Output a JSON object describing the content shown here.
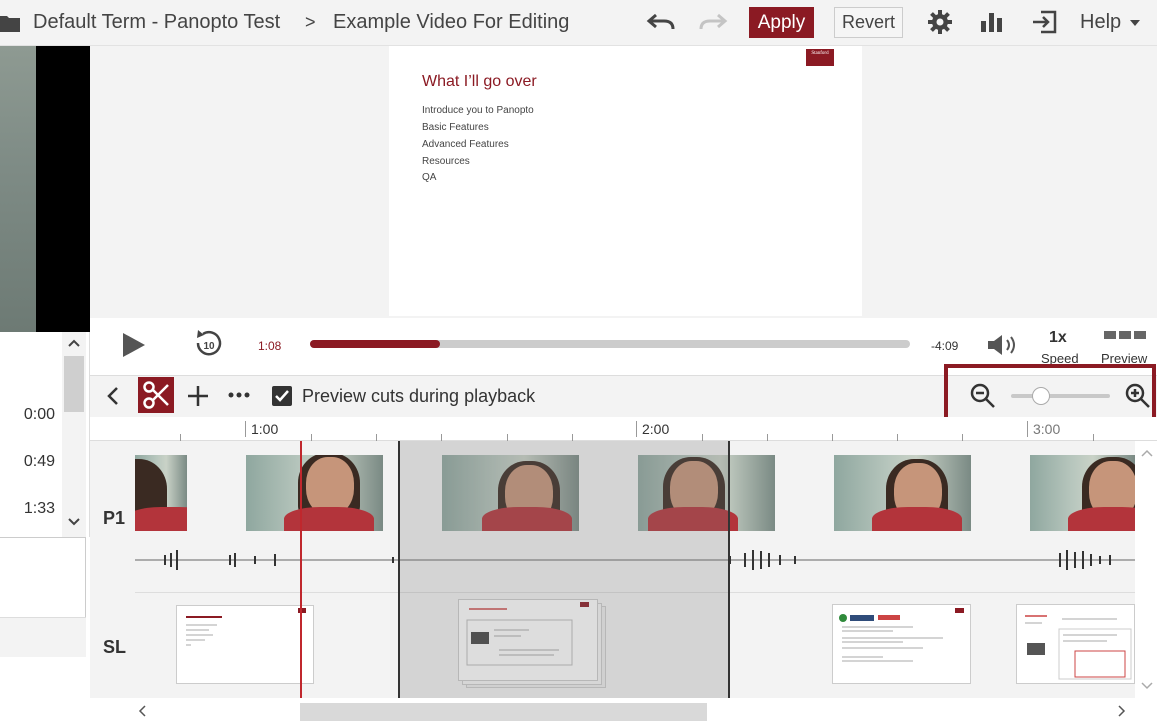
{
  "header": {
    "folder": "Default Term - Panopto Test",
    "separator": ">",
    "session": "Example Video For Editing",
    "apply_label": "Apply",
    "revert_label": "Revert",
    "help_label": "Help"
  },
  "left_panel": {
    "times": [
      "0:00",
      "0:49",
      "1:33"
    ]
  },
  "slide": {
    "title": "What I’ll go over",
    "bullets": [
      "Introduce you to Panopto",
      "Basic Features",
      "Advanced Features",
      "Resources",
      "QA"
    ],
    "logo": "Stanford"
  },
  "player": {
    "current_time": "1:08",
    "remaining_time": "-4:09",
    "progress": 0.217,
    "speed_value": "1x",
    "speed_label": "Speed",
    "preview_label": "Preview"
  },
  "toolbar": {
    "preview_cuts_label": "Preview cuts during playback",
    "preview_cuts_checked": true,
    "zoom_level": 0.3
  },
  "timeline": {
    "ruler_labels": [
      "1:00",
      "2:00",
      "3:00"
    ],
    "tracks": [
      "P1",
      "SL"
    ]
  },
  "colors": {
    "accent": "#8b1a23",
    "playhead": "#c0272d"
  }
}
